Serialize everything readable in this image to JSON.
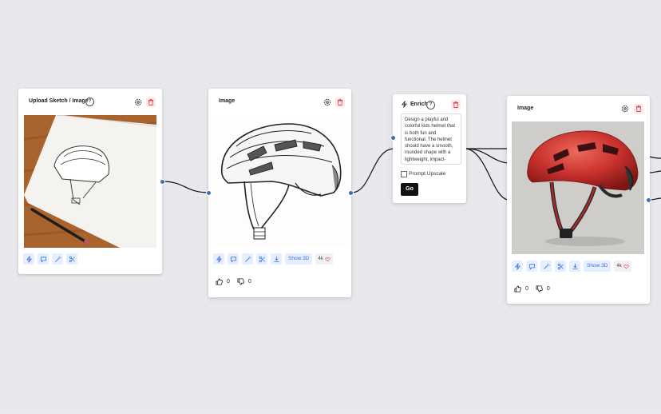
{
  "nodes": {
    "upload": {
      "title": "Upload Sketch / Image",
      "help": "?"
    },
    "image1": {
      "title": "Image",
      "show3d": "Show 3D",
      "likes": "4k",
      "upvotes": "0",
      "downvotes": "0"
    },
    "enrich": {
      "title": "Enrich",
      "help": "?",
      "prompt": "Design a playful and colorful kids helmet that is both fun and functional. The helmet should have a smooth, rounded shape with a lightweight, impact-resistant outer shell",
      "upscale_label": "Prompt Upscale",
      "go_label": "Go"
    },
    "image2": {
      "title": "Image",
      "show3d": "Show 3D",
      "likes": "4k",
      "upvotes": "0",
      "downvotes": "0"
    }
  },
  "colors": {
    "accent": "#3a6fd8",
    "port": "#3b6fb6",
    "danger": "#e5484d",
    "helmet_red": "#c8302c"
  }
}
